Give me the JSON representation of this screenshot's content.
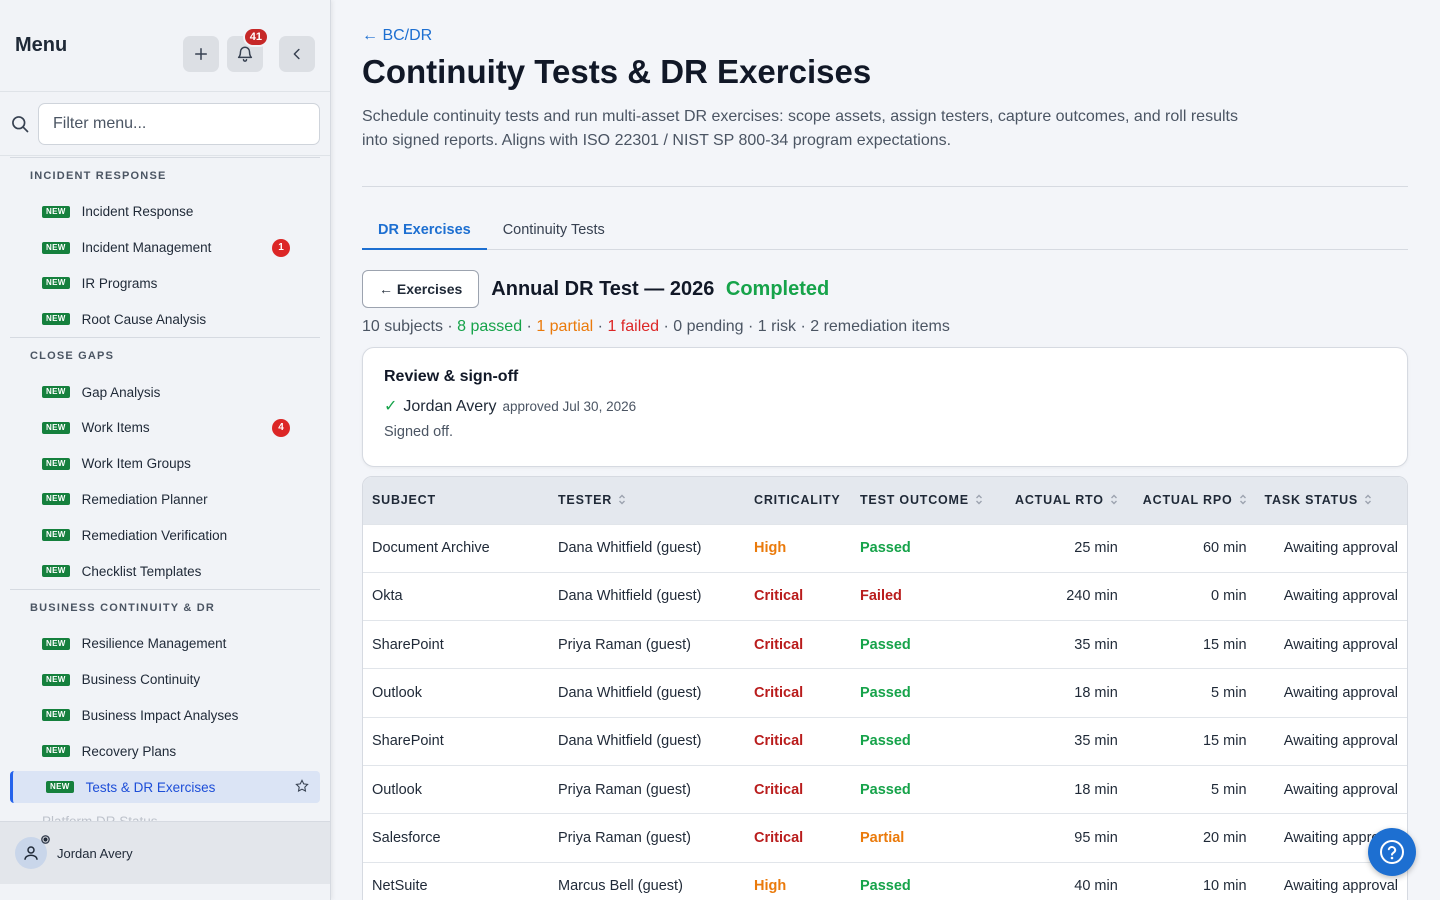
{
  "sidebar": {
    "title": "Menu",
    "notification_count": "41",
    "filter_placeholder": "Filter menu...",
    "new_label": "NEW",
    "sections": [
      {
        "title": "INCIDENT RESPONSE",
        "items": [
          {
            "label": "Incident Response",
            "badge": ""
          },
          {
            "label": "Incident Management",
            "badge": "1"
          },
          {
            "label": "IR Programs",
            "badge": ""
          },
          {
            "label": "Root Cause Analysis",
            "badge": ""
          }
        ]
      },
      {
        "title": "CLOSE GAPS",
        "items": [
          {
            "label": "Gap Analysis",
            "badge": ""
          },
          {
            "label": "Work Items",
            "badge": "4"
          },
          {
            "label": "Work Item Groups",
            "badge": ""
          },
          {
            "label": "Remediation Planner",
            "badge": ""
          },
          {
            "label": "Remediation Verification",
            "badge": ""
          },
          {
            "label": "Checklist Templates",
            "badge": ""
          }
        ]
      },
      {
        "title": "BUSINESS CONTINUITY & DR",
        "items": [
          {
            "label": "Resilience Management",
            "badge": ""
          },
          {
            "label": "Business Continuity",
            "badge": ""
          },
          {
            "label": "Business Impact Analyses",
            "badge": ""
          },
          {
            "label": "Recovery Plans",
            "badge": ""
          },
          {
            "label": "Tests & DR Exercises",
            "badge": "",
            "active": true
          },
          {
            "label": "Platform DR Status",
            "badge": "",
            "faded": true
          }
        ]
      }
    ],
    "user": {
      "name": "Jordan Avery"
    }
  },
  "main": {
    "breadcrumb": "← BC/DR",
    "title": "Continuity Tests & DR Exercises",
    "description": "Schedule continuity tests and run multi-asset DR exercises: scope assets, assign testers, capture outcomes, and roll results into signed reports. Aligns with ISO 22301 / NIST SP 800-34 program expectations.",
    "tabs": [
      {
        "label": "DR Exercises",
        "active": true
      },
      {
        "label": "Continuity Tests",
        "active": false
      }
    ],
    "exercise": {
      "back_label": "← Exercises",
      "name": "Annual DR Test — 2026",
      "status": "Completed",
      "summary": {
        "subjects": "10 subjects",
        "passed": "8 passed",
        "partial": "1 partial",
        "failed": "1 failed",
        "pending": "0 pending",
        "risk": "1 risk",
        "remediation": "2 remediation items",
        "separator": " · "
      }
    },
    "review": {
      "title": "Review & sign-off",
      "check": "✓",
      "approver": "Jordan Avery",
      "approved_text": "approved Jul 30, 2026",
      "signed_text": "Signed off."
    },
    "table": {
      "columns": [
        "SUBJECT",
        "TESTER",
        "CRITICALITY",
        "TEST OUTCOME",
        "ACTUAL RTO",
        "ACTUAL RPO",
        "TASK STATUS"
      ],
      "rows": [
        [
          "Document Archive",
          "Dana Whitfield (guest)",
          "High",
          "Passed",
          "25 min",
          "60 min",
          "Awaiting approval"
        ],
        [
          "Okta",
          "Dana Whitfield (guest)",
          "Critical",
          "Failed",
          "240 min",
          "0 min",
          "Awaiting approval"
        ],
        [
          "SharePoint",
          "Priya Raman (guest)",
          "Critical",
          "Passed",
          "35 min",
          "15 min",
          "Awaiting approval"
        ],
        [
          "Outlook",
          "Dana Whitfield (guest)",
          "Critical",
          "Passed",
          "18 min",
          "5 min",
          "Awaiting approval"
        ],
        [
          "SharePoint",
          "Dana Whitfield (guest)",
          "Critical",
          "Passed",
          "35 min",
          "15 min",
          "Awaiting approval"
        ],
        [
          "Outlook",
          "Priya Raman (guest)",
          "Critical",
          "Passed",
          "18 min",
          "5 min",
          "Awaiting approval"
        ],
        [
          "Salesforce",
          "Priya Raman (guest)",
          "Critical",
          "Partial",
          "95 min",
          "20 min",
          "Awaiting approval"
        ],
        [
          "NetSuite",
          "Marcus Bell (guest)",
          "High",
          "Passed",
          "40 min",
          "10 min",
          "Awaiting approval"
        ]
      ]
    }
  },
  "colors": {
    "accent": "#1d6fd1",
    "success": "#16a34a",
    "warning": "#ea7a0b",
    "danger": "#b91c1c",
    "new_badge": "#15803d"
  },
  "icons": {
    "add": "plus-icon",
    "notifications": "bell-icon",
    "collapse": "chevron-left-icon",
    "filter": "search-icon",
    "favorite": "star-icon",
    "user": "user-icon",
    "help": "help-icon",
    "sort": "sort-icon"
  }
}
